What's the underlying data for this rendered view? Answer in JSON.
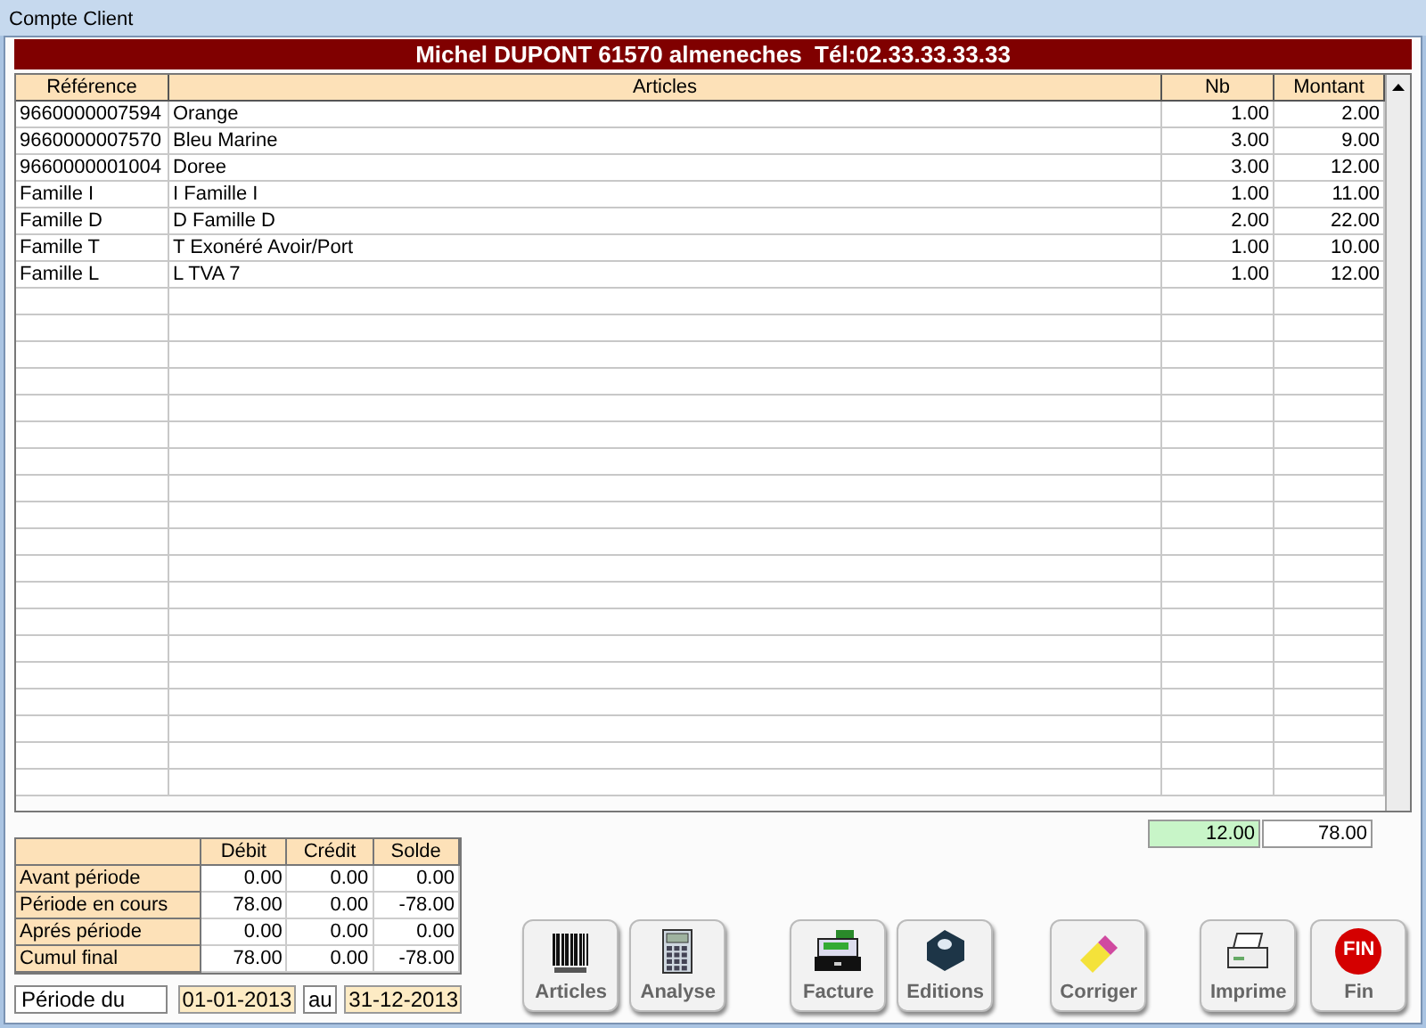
{
  "window": {
    "title": "Compte Client"
  },
  "header": "Michel DUPONT 61570 almeneches  Tél:02.33.33.33.33",
  "table": {
    "columns": [
      "Référence",
      "Articles",
      "Nb",
      "Montant"
    ],
    "rows": [
      [
        "9660000007594",
        "Orange",
        "1.00",
        "2.00"
      ],
      [
        "9660000007570",
        "Bleu Marine",
        "3.00",
        "9.00"
      ],
      [
        "9660000001004",
        "Doree",
        "3.00",
        "12.00"
      ],
      [
        "Famille I",
        "I Famille I",
        "1.00",
        "11.00"
      ],
      [
        "Famille D",
        "D Famille D",
        "2.00",
        "22.00"
      ],
      [
        "Famille T",
        "T Exonéré Avoir/Port",
        "1.00",
        "10.00"
      ],
      [
        "Famille L",
        "L TVA 7",
        "1.00",
        "12.00"
      ]
    ]
  },
  "totals": {
    "nb": "12.00",
    "montant": "78.00"
  },
  "summary": {
    "columns": [
      "Débit",
      "Crédit",
      "Solde"
    ],
    "rows": [
      {
        "label": "Avant période",
        "values": [
          "0.00",
          "0.00",
          "0.00"
        ]
      },
      {
        "label": "Période en cours",
        "values": [
          "78.00",
          "0.00",
          "-78.00"
        ]
      },
      {
        "label": "Aprés période",
        "values": [
          "0.00",
          "0.00",
          "0.00"
        ]
      },
      {
        "label": "Cumul final",
        "values": [
          "78.00",
          "0.00",
          "-78.00"
        ]
      }
    ]
  },
  "period": {
    "label": "Période du",
    "from": "01-01-2013",
    "to_label": "au",
    "to": "31-12-2013"
  },
  "buttons": [
    {
      "kind": "barcode",
      "label": "Articles"
    },
    {
      "kind": "calculator",
      "label": "Analyse"
    },
    {
      "kind": "register",
      "label": "Facture"
    },
    {
      "kind": "printer-round",
      "label": "Editions"
    },
    {
      "kind": "eraser",
      "label": "Corriger"
    },
    {
      "kind": "printer",
      "label": "Imprime"
    },
    {
      "kind": "stop",
      "label": "Fin",
      "sign": "FIN"
    }
  ]
}
